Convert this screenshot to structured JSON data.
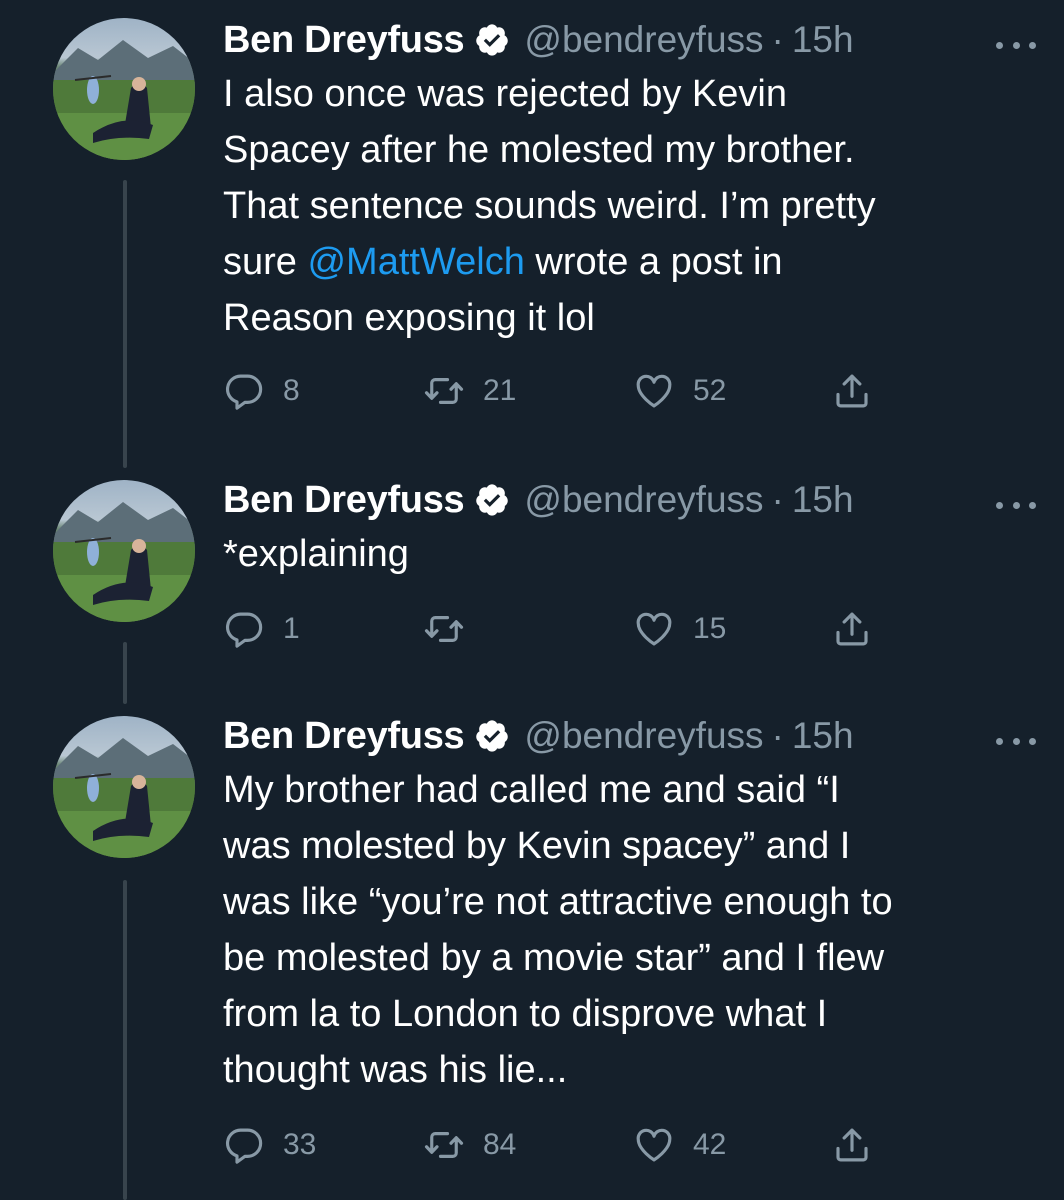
{
  "colors": {
    "background": "#15202b",
    "text": "#ffffff",
    "muted": "#8899a6",
    "link": "#1d9bf0",
    "thread_line": "#38444d"
  },
  "tweets": [
    {
      "author": "Ben Dreyfuss",
      "handle": "@bendreyfuss",
      "separator": "·",
      "time": "15h",
      "text_before": "I also once was rejected by Kevin\nSpacey after he molested my brother.\nThat sentence sounds weird. I’m pretty\nsure ",
      "mention": "@MattWelch",
      "text_after": " wrote a post in\nReason exposing it lol",
      "replies": "8",
      "retweets": "21",
      "likes": "52"
    },
    {
      "author": "Ben Dreyfuss",
      "handle": "@bendreyfuss",
      "separator": "·",
      "time": "15h",
      "text_before": "*explaining",
      "mention": "",
      "text_after": "",
      "replies": "1",
      "retweets": "",
      "likes": "15"
    },
    {
      "author": "Ben Dreyfuss",
      "handle": "@bendreyfuss",
      "separator": "·",
      "time": "15h",
      "text_before": "My brother had called me and said “I\nwas molested by Kevin spacey” and I\nwas like “you’re not attractive enough to\nbe molested by a movie star” and I flew\nfrom la to London to disprove what I\nthought was his lie...",
      "mention": "",
      "text_after": "",
      "replies": "33",
      "retweets": "84",
      "likes": "42"
    }
  ],
  "icons": {
    "reply": "reply-icon",
    "retweet": "retweet-icon",
    "like": "heart-icon",
    "share": "share-icon",
    "verified": "verified-badge-icon",
    "more": "more-options-icon"
  }
}
